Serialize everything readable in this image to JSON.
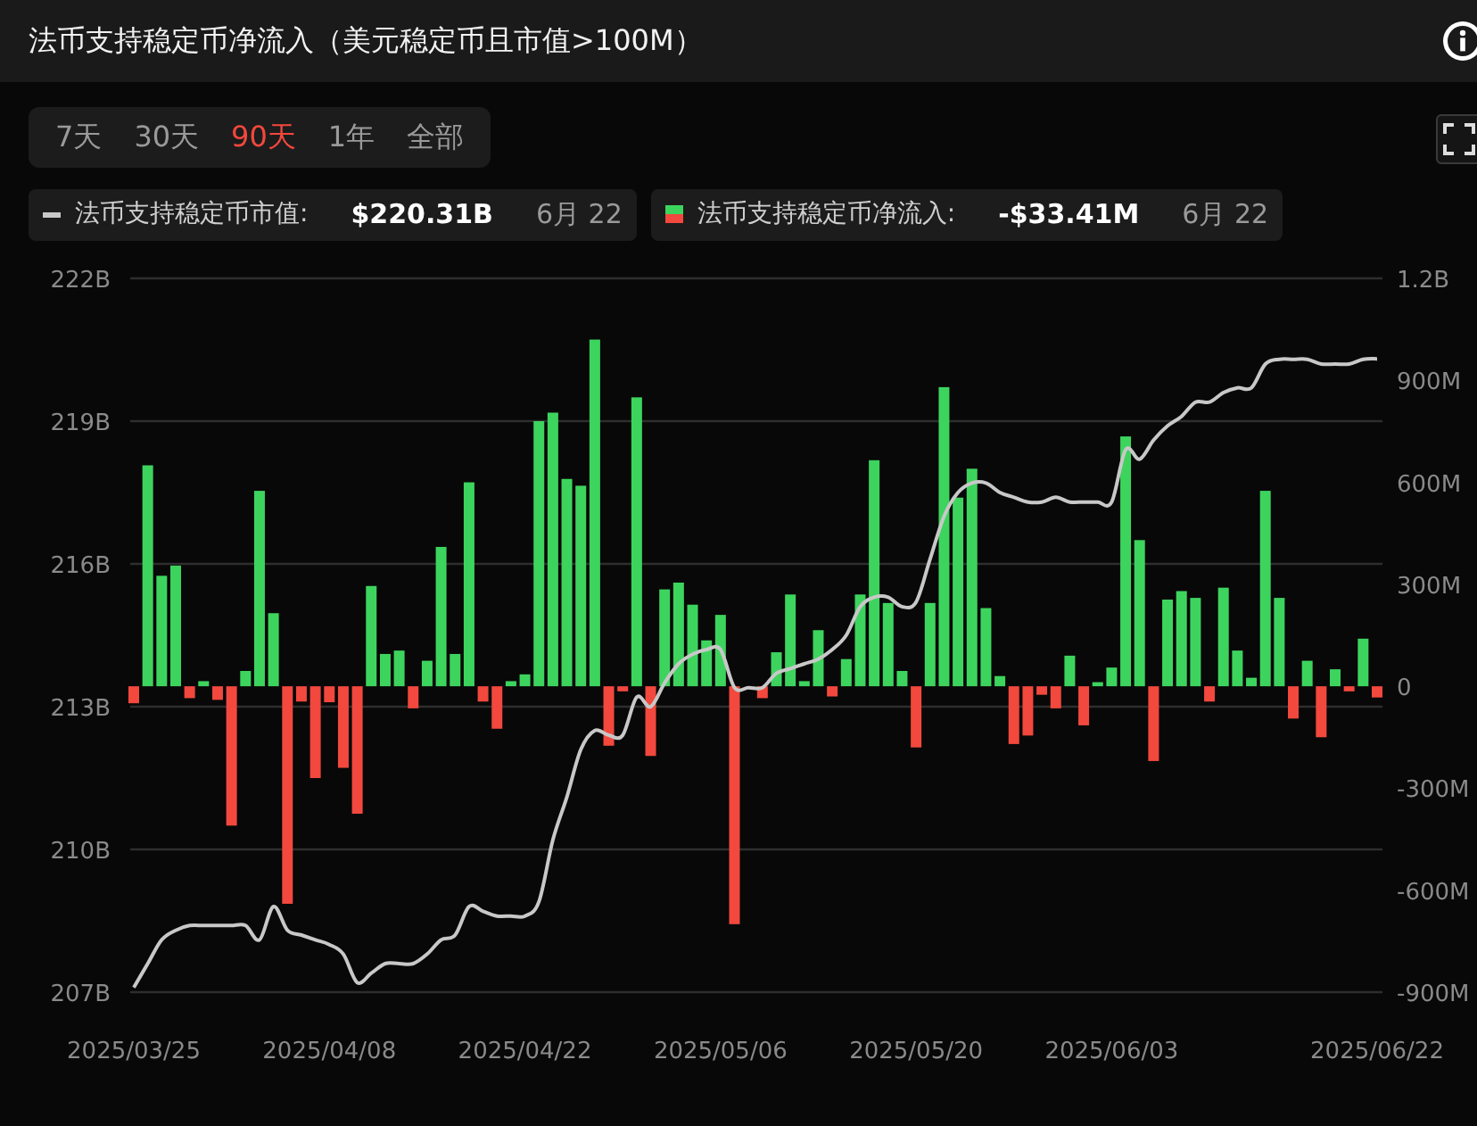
{
  "header": {
    "title": "法币支持稳定币净流入（美元稳定币且市值>100M）"
  },
  "range_tabs": [
    {
      "label": "7天",
      "selected": false
    },
    {
      "label": "30天",
      "selected": false
    },
    {
      "label": "90天",
      "selected": true
    },
    {
      "label": "1年",
      "selected": false
    },
    {
      "label": "全部",
      "selected": false
    }
  ],
  "legend": [
    {
      "kind": "line",
      "colon": ":",
      "value": "$220.31B",
      "date": "6月 22"
    },
    {
      "kind": "bar",
      "colon": ":",
      "value": "-$33.41M",
      "date": "6月 22"
    }
  ],
  "chart_data": {
    "type": "bar",
    "grid": true,
    "ylim": [
      207,
      222
    ],
    "y2lim": [
      -900000000,
      1200000000
    ],
    "categories": [
      "2025/03/25",
      null,
      null,
      null,
      null,
      null,
      null,
      null,
      null,
      null,
      null,
      null,
      null,
      null,
      "2025/04/08",
      null,
      null,
      null,
      null,
      null,
      null,
      null,
      null,
      null,
      null,
      null,
      null,
      null,
      "2025/04/22",
      null,
      null,
      null,
      null,
      null,
      null,
      null,
      null,
      null,
      null,
      null,
      null,
      null,
      "2025/05/06",
      null,
      null,
      null,
      null,
      null,
      null,
      null,
      null,
      null,
      null,
      null,
      null,
      null,
      "2025/05/20",
      null,
      null,
      null,
      null,
      null,
      null,
      null,
      null,
      null,
      null,
      null,
      null,
      null,
      "2025/06/03",
      null,
      null,
      null,
      null,
      null,
      null,
      null,
      null,
      null,
      null,
      null,
      null,
      null,
      null,
      null,
      null,
      null,
      null,
      "2025/06/22"
    ],
    "yticks": [
      {
        "value": 222,
        "label": "222B"
      },
      {
        "value": 219,
        "label": "219B"
      },
      {
        "value": 216,
        "label": "216B"
      },
      {
        "value": 213,
        "label": "213B"
      },
      {
        "value": 210,
        "label": "210B"
      },
      {
        "value": 207,
        "label": "207B"
      }
    ],
    "y2ticks": [
      {
        "value": 1200000000,
        "label": "1.2B"
      },
      {
        "value": 900000000,
        "label": "900M"
      },
      {
        "value": 600000000,
        "label": "600M"
      },
      {
        "value": 300000000,
        "label": "300M"
      },
      {
        "value": 0,
        "label": "0"
      },
      {
        "value": -300000000,
        "label": "-300M"
      },
      {
        "value": -600000000,
        "label": "-600M"
      },
      {
        "value": -900000000,
        "label": "-900M"
      }
    ],
    "series": [
      {
        "name": "法币支持稳定币市值",
        "type": "line",
        "color": "#c8c8c8",
        "values": [
          207.1,
          207.6,
          208.1,
          208.3,
          208.4,
          208.4,
          208.4,
          208.4,
          208.4,
          208.1,
          208.8,
          208.3,
          208.2,
          208.1,
          208.0,
          207.8,
          207.2,
          207.4,
          207.6,
          207.6,
          207.6,
          207.8,
          208.1,
          208.2,
          208.8,
          208.7,
          208.6,
          208.6,
          208.6,
          208.9,
          210.2,
          211.1,
          212.1,
          212.5,
          212.4,
          212.4,
          213.2,
          213.0,
          213.5,
          213.9,
          214.1,
          214.2,
          214.2,
          213.4,
          213.4,
          213.4,
          213.7,
          213.8,
          213.9,
          214.0,
          214.2,
          214.5,
          215.1,
          215.3,
          215.3,
          215.1,
          215.2,
          216.1,
          217.0,
          217.5,
          217.7,
          217.7,
          217.5,
          217.4,
          217.3,
          217.3,
          217.4,
          217.3,
          217.3,
          217.3,
          217.3,
          218.4,
          218.2,
          218.6,
          218.9,
          219.1,
          219.4,
          219.4,
          219.6,
          219.7,
          219.7,
          220.2,
          220.3,
          220.3,
          220.3,
          220.2,
          220.2,
          220.2,
          220.3,
          220.31
        ]
      },
      {
        "name": "法币支持稳定币净流入",
        "type": "bar",
        "axis": "y2",
        "color": "#3dd45e",
        "values": [
          null,
          650000000,
          325000000,
          355000000,
          null,
          15000000,
          null,
          null,
          45000000,
          575000000,
          215000000,
          null,
          null,
          null,
          null,
          null,
          null,
          295000000,
          95000000,
          105000000,
          null,
          75000000,
          410000000,
          95000000,
          600000000,
          null,
          null,
          15000000,
          35000000,
          780000000,
          805000000,
          610000000,
          590000000,
          1020000000,
          null,
          null,
          850000000,
          null,
          285000000,
          305000000,
          240000000,
          135000000,
          210000000,
          null,
          0,
          null,
          100000000,
          270000000,
          15000000,
          165000000,
          null,
          80000000,
          270000000,
          665000000,
          245000000,
          45000000,
          null,
          245000000,
          880000000,
          555000000,
          640000000,
          230000000,
          30000000,
          null,
          null,
          null,
          null,
          90000000,
          null,
          12000000,
          55000000,
          735000000,
          430000000,
          null,
          255000000,
          280000000,
          260000000,
          null,
          290000000,
          105000000,
          25000000,
          575000000,
          260000000,
          null,
          75000000,
          null,
          50000000,
          null,
          140000000,
          null
        ]
      },
      {
        "type": "bar",
        "axis": "y2",
        "color": "#f2483d",
        "values": [
          -50000000,
          null,
          null,
          null,
          -35000000,
          null,
          -40000000,
          -410000000,
          null,
          null,
          null,
          -640000000,
          -45000000,
          -270000000,
          -47000000,
          -240000000,
          -375000000,
          null,
          null,
          null,
          -65000000,
          null,
          null,
          null,
          null,
          -45000000,
          -125000000,
          null,
          null,
          null,
          null,
          null,
          null,
          null,
          -175000000,
          -15000000,
          null,
          -205000000,
          null,
          null,
          null,
          null,
          null,
          -700000000,
          null,
          -35000000,
          null,
          null,
          null,
          null,
          -30000000,
          null,
          null,
          null,
          null,
          null,
          -180000000,
          null,
          null,
          null,
          null,
          null,
          null,
          -170000000,
          -145000000,
          -25000000,
          -65000000,
          null,
          -115000000,
          null,
          null,
          null,
          null,
          -220000000,
          null,
          null,
          null,
          -45000000,
          null,
          null,
          null,
          null,
          null,
          -95000000,
          null,
          -150000000,
          null,
          -15000000,
          null,
          -33000000
        ]
      }
    ]
  }
}
